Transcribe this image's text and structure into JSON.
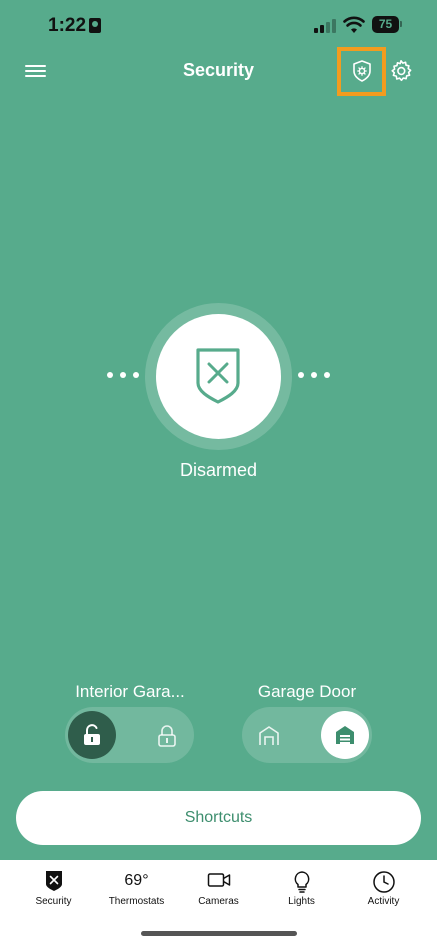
{
  "status_bar": {
    "time": "1:22",
    "battery": "75"
  },
  "header": {
    "title": "Security"
  },
  "arm": {
    "status": "Disarmed"
  },
  "devices": [
    {
      "label": "Interior Gara...",
      "state": "unlocked"
    },
    {
      "label": "Garage Door",
      "state": "closed"
    }
  ],
  "shortcuts": {
    "label": "Shortcuts"
  },
  "tabs": [
    {
      "label": "Security",
      "icon": "shield-x-icon"
    },
    {
      "label": "Thermostats",
      "value": "69°",
      "icon": "thermostat-icon"
    },
    {
      "label": "Cameras",
      "icon": "camera-icon"
    },
    {
      "label": "Lights",
      "icon": "bulb-icon"
    },
    {
      "label": "Activity",
      "icon": "clock-icon"
    }
  ],
  "colors": {
    "background": "#57ab8c",
    "highlight": "#f39c1f",
    "dark_knob": "#2f5d4b",
    "accent_text": "#3d8e6e"
  }
}
